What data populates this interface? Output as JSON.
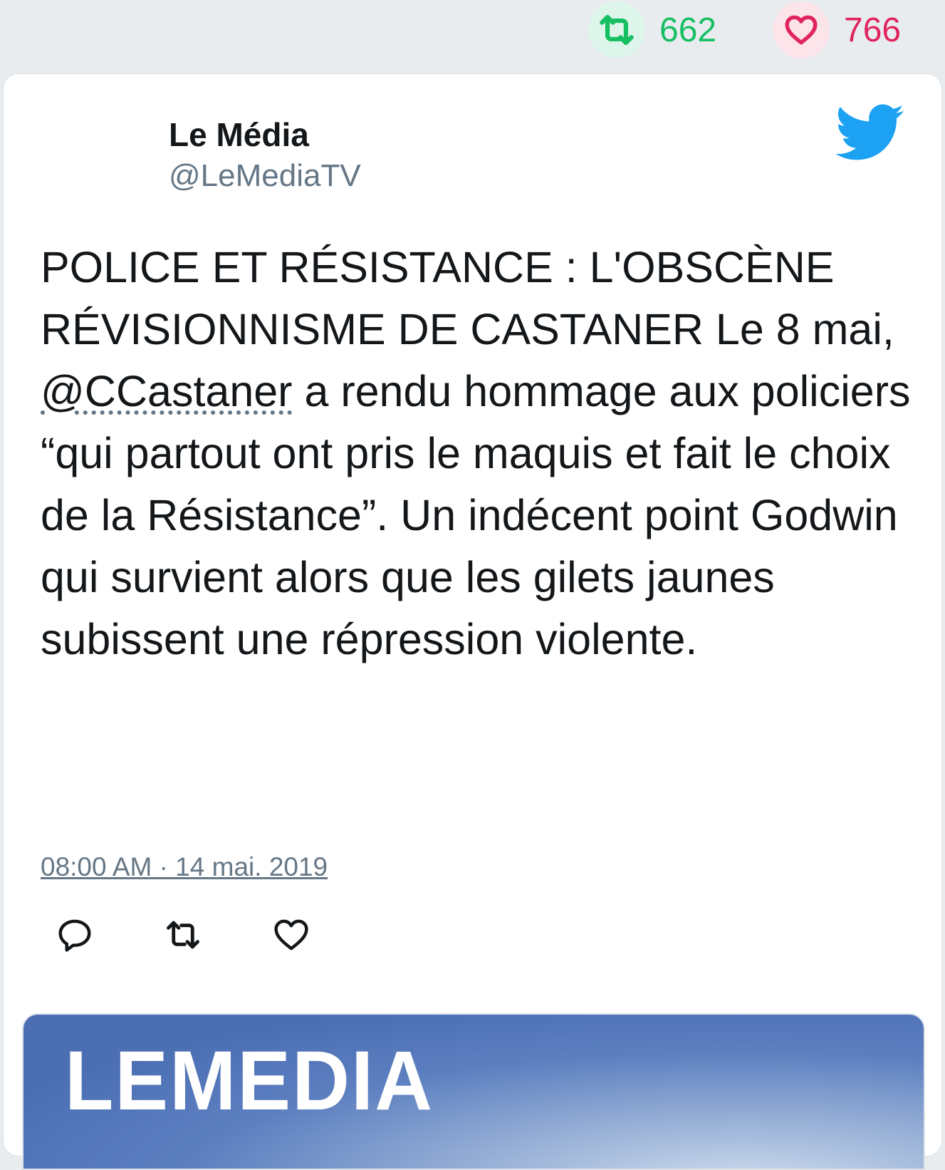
{
  "stats": {
    "retweets": "662",
    "likes": "766"
  },
  "tweet": {
    "author_name": "Le Média",
    "author_handle": "@LeMediaTV",
    "text_before_mention": "POLICE ET RÉSISTANCE : L'OBSCÈNE RÉVISIONNISME DE CASTANER Le 8 mai, ",
    "mention": "@CCastaner",
    "text_after_mention": " a rendu hommage aux policiers “qui partout ont pris le maquis et fait le choix de la Résistance”. Un indécent point Godwin qui survient alors que les gilets jaunes subissent une répression violente.",
    "timestamp": "08:00 AM · 14 mai. 2019"
  },
  "preview": {
    "logo_text": "LEMEDIA"
  },
  "colors": {
    "retweet_green": "#17bf63",
    "like_red": "#e0245e",
    "twitter_blue": "#1da1f2",
    "secondary_gray": "#657786"
  },
  "icons": {
    "retweet": "retweet-icon",
    "like": "heart-icon",
    "reply": "reply-icon",
    "brand": "twitter-bird-icon"
  }
}
